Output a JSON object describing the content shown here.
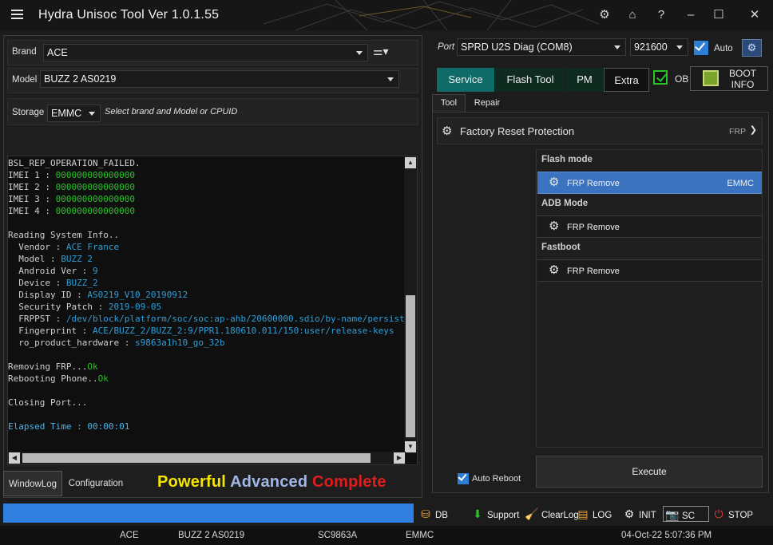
{
  "app": {
    "title": "Hydra Unisoc Tool  Ver 1.0.1.55"
  },
  "left": {
    "brand_label": "Brand",
    "brand_value": "ACE",
    "model_label": "Model",
    "model_value": "BUZZ 2  AS0219",
    "storage_label": "Storage",
    "storage_value": "EMMC",
    "hint": "Select brand and Model or CPUID"
  },
  "log": {
    "lines": [
      [
        {
          "t": "BSL_REP_OPERATION_FAILED.",
          "c": ""
        }
      ],
      [
        {
          "t": "IMEI 1 : ",
          "c": ""
        },
        {
          "t": "000000000000000",
          "c": "c-green"
        }
      ],
      [
        {
          "t": "IMEI 2 : ",
          "c": ""
        },
        {
          "t": "000000000000000",
          "c": "c-green"
        }
      ],
      [
        {
          "t": "IMEI 3 : ",
          "c": ""
        },
        {
          "t": "000000000000000",
          "c": "c-green"
        }
      ],
      [
        {
          "t": "IMEI 4 : ",
          "c": ""
        },
        {
          "t": "000000000000000",
          "c": "c-green"
        }
      ],
      [
        {
          "t": "",
          "c": ""
        }
      ],
      [
        {
          "t": "Reading System Info..",
          "c": ""
        }
      ],
      [
        {
          "t": "  Vendor : ",
          "c": ""
        },
        {
          "t": "ACE France",
          "c": "c-blue"
        }
      ],
      [
        {
          "t": "  Model : ",
          "c": ""
        },
        {
          "t": "BUZZ 2",
          "c": "c-blue"
        }
      ],
      [
        {
          "t": "  Android Ver : ",
          "c": ""
        },
        {
          "t": "9",
          "c": "c-blue"
        }
      ],
      [
        {
          "t": "  Device : ",
          "c": ""
        },
        {
          "t": "BUZZ_2",
          "c": "c-blue"
        }
      ],
      [
        {
          "t": "  Display ID : ",
          "c": ""
        },
        {
          "t": "AS0219_V10_20190912",
          "c": "c-blue"
        }
      ],
      [
        {
          "t": "  Security Patch : ",
          "c": ""
        },
        {
          "t": "2019-09-05",
          "c": "c-blue"
        }
      ],
      [
        {
          "t": "  FRPPST : ",
          "c": ""
        },
        {
          "t": "/dev/block/platform/soc/soc:ap-ahb/20600000.sdio/by-name/persist",
          "c": "c-blue"
        }
      ],
      [
        {
          "t": "  Fingerprint : ",
          "c": ""
        },
        {
          "t": "ACE/BUZZ_2/BUZZ_2:9/PPR1.180610.011/150:user/release-keys",
          "c": "c-blue"
        }
      ],
      [
        {
          "t": "  ro_product_hardware : ",
          "c": ""
        },
        {
          "t": "s9863a1h10_go_32b",
          "c": "c-blue"
        }
      ],
      [
        {
          "t": "",
          "c": ""
        }
      ],
      [
        {
          "t": "Removing FRP...",
          "c": ""
        },
        {
          "t": "Ok",
          "c": "c-green"
        }
      ],
      [
        {
          "t": "Rebooting Phone..",
          "c": ""
        },
        {
          "t": "Ok",
          "c": "c-green"
        }
      ],
      [
        {
          "t": "",
          "c": ""
        }
      ],
      [
        {
          "t": "Closing Port...",
          "c": ""
        }
      ],
      [
        {
          "t": "",
          "c": ""
        }
      ],
      [
        {
          "t": "Elapsed Time : 00:00:01",
          "c": "c-cyan"
        }
      ]
    ]
  },
  "bottom_tabs": {
    "windowlog": "WindowLog",
    "configuration": "Configuration"
  },
  "tagline": {
    "w1": "Powerful",
    "w2": "Advanced",
    "w3": "Complete",
    "c1": "#f5e600",
    "c2": "#9fb7e8",
    "c3": "#e01d1d"
  },
  "right": {
    "port_label": "Port",
    "port_value": "SPRD U2S Diag (COM8)",
    "baud_value": "921600",
    "auto_label": "Auto",
    "auto_checked": true,
    "tabs": [
      "Service",
      "Flash Tool",
      "PM",
      "Extra"
    ],
    "ob_label": "OB",
    "ob_checked": true,
    "boot_info_line1": "BOOT",
    "boot_info_line2": "INFO",
    "subtabs": [
      "Tool",
      "Repair"
    ],
    "section_title": "Factory Reset Protection",
    "section_tag": "FRP",
    "groups": [
      {
        "title": "Flash mode",
        "item": "FRP Remove",
        "tag": "EMMC",
        "active": true
      },
      {
        "title": "ADB Mode",
        "item": "FRP Remove",
        "tag": "",
        "active": false
      },
      {
        "title": "Fastboot",
        "item": "FRP Remove",
        "tag": "",
        "active": false
      }
    ],
    "auto_reboot_label": "Auto Reboot",
    "auto_reboot_checked": true,
    "execute_label": "Execute"
  },
  "progress": {
    "percent": 100,
    "color": "#2f7fe0"
  },
  "toolbar": {
    "db": "DB",
    "support": "Support",
    "clearlog": "ClearLog",
    "log": "LOG",
    "init": "INIT",
    "sc": "SC",
    "stop": "STOP"
  },
  "statusbar": {
    "brand": "ACE",
    "model": "BUZZ 2  AS0219",
    "cpu": "SC9863A",
    "storage": "EMMC",
    "datetime": "04-Oct-22 5:07:36 PM"
  }
}
